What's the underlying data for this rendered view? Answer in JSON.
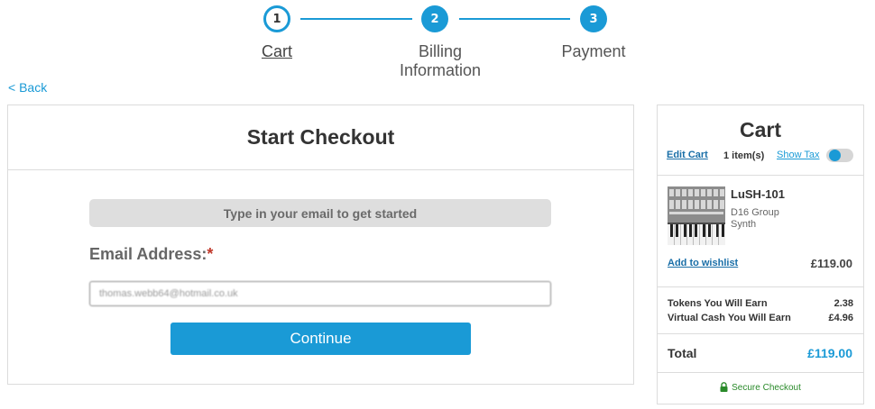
{
  "stepper": {
    "steps": [
      {
        "number": "1",
        "label_line1": "Cart",
        "label_line2": ""
      },
      {
        "number": "2",
        "label_line1": "Billing",
        "label_line2": "Information"
      },
      {
        "number": "3",
        "label_line1": "Payment",
        "label_line2": ""
      }
    ],
    "accent_color": "#1a9ad6"
  },
  "nav": {
    "back_label": "< Back"
  },
  "checkout": {
    "title": "Start Checkout",
    "hint": "Type in your email to get started",
    "email_label": "Email Address:",
    "required_marker": "*",
    "email_value": "thomas.webb64@hotmail.co.uk",
    "continue_label": "Continue"
  },
  "cart": {
    "title": "Cart",
    "edit_label": "Edit Cart",
    "item_count": "1 item(s)",
    "show_tax_label": "Show Tax",
    "product": {
      "name": "LuSH-101",
      "brand": "D16 Group",
      "category": "Synth",
      "wishlist_label": "Add to wishlist",
      "price": "£119.00"
    },
    "tokens_label": "Tokens You Will Earn",
    "tokens_value": "2.38",
    "cash_label": "Virtual Cash You Will Earn",
    "cash_value": "£4.96",
    "total_label": "Total",
    "total_value": "£119.00",
    "secure_label": "Secure Checkout"
  }
}
